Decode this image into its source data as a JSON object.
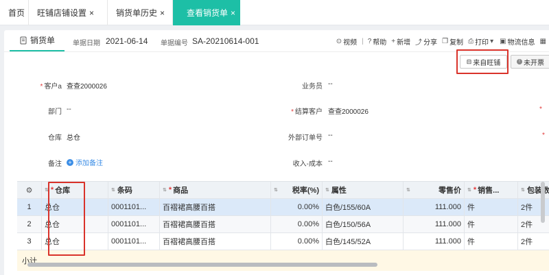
{
  "top_tabs": [
    {
      "label": "首页",
      "closable": false,
      "active": false
    },
    {
      "label": "旺铺店铺设置",
      "closable": true,
      "active": false
    },
    {
      "label": "销货单历史",
      "closable": true,
      "active": false
    },
    {
      "label": "查看销货单",
      "closable": true,
      "active": true
    }
  ],
  "close_glyph": "×",
  "doc": {
    "tab_label": "销货单",
    "date_label": "单据日期",
    "date_value": "2021-06-14",
    "no_label": "单据编号",
    "no_value": "SA-20210614-001"
  },
  "toolbar": {
    "video": "视频",
    "help": "帮助",
    "new": "新增",
    "share": "分享",
    "copy": "复制",
    "print": "打印",
    "logistics": "物流信息"
  },
  "badges": {
    "source": "来自旺铺",
    "invoice": "未开票"
  },
  "form": {
    "customer_label": "客户a",
    "customer_value": "查查2000026",
    "salesman_label": "业务员",
    "salesman_value": "--",
    "dept_label": "部门",
    "dept_value": "--",
    "settle_label": "结算客户",
    "settle_value": "查查2000026",
    "warehouse_label": "仓库",
    "warehouse_value": "总仓",
    "ext_order_label": "外部订单号",
    "ext_order_value": "--",
    "remark_label": "备注",
    "remark_add": "添加备注",
    "income_label": "收入-成本",
    "income_value": "--"
  },
  "table": {
    "headers": {
      "warehouse": "仓库",
      "barcode": "条码",
      "product": "商品",
      "tax": "税率(%)",
      "attr": "属性",
      "price": "零售价",
      "unit": "销售...",
      "pack": "包装数"
    },
    "rows": [
      {
        "no": "1",
        "warehouse": "总仓",
        "barcode": "0001101...",
        "product": "百褶裙高腰百搭",
        "tax": "0.00%",
        "attr": "白色/155/60A",
        "price": "111.000",
        "unit": "件",
        "pack": "2件"
      },
      {
        "no": "2",
        "warehouse": "总仓",
        "barcode": "0001101...",
        "product": "百褶裙高腰百搭",
        "tax": "0.00%",
        "attr": "白色/150/56A",
        "price": "111.000",
        "unit": "件",
        "pack": "2件"
      },
      {
        "no": "3",
        "warehouse": "总仓",
        "barcode": "0001101...",
        "product": "百褶裙高腰百搭",
        "tax": "0.00%",
        "attr": "白色/145/52A",
        "price": "111.000",
        "unit": "件",
        "pack": "2件"
      }
    ],
    "subtotal_label": "小计"
  },
  "colors": {
    "accent": "#1dbfa6",
    "highlight": "#d9322a",
    "link": "#3c8ee6",
    "selected_row": "#dbe9f9"
  }
}
